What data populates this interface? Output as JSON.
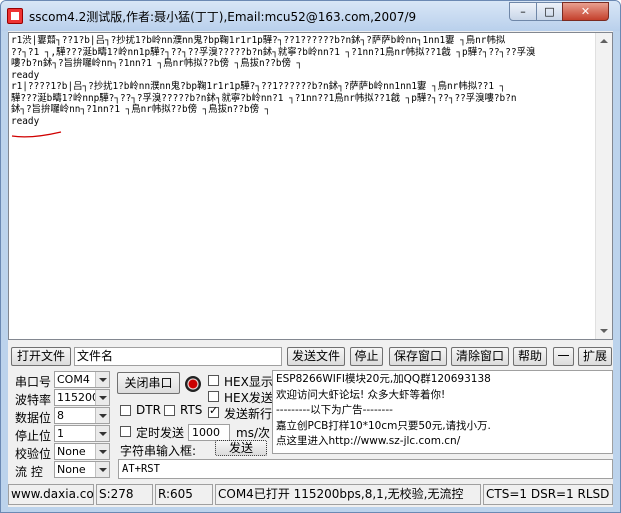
{
  "title": "sscom4.2测试版,作者:聂小猛(丁丁),Email:mcu52@163.com,2007/9",
  "window_controls": {
    "minimize": "–",
    "maximize": "□",
    "close": "✕"
  },
  "receive": {
    "lines": [
      "r1渋|寠鼘┐??1?b|吕┐?抄扰1?b岭nn濮nn鬼?bp鞠1r1r1p驊?┐??1??????b?n鉥┐?萨萨b岭nn┐1nn1寠 ┐鳥nr帏拟",
      "??┐?1 ┐,驊???涎b疇1?岭nn1p驊?┐??┐??孚溴?????b?n鉥┐就寧?b岭nn?1 ┐?1nn?1鳥nr帏拟??1戧 ┐p驊?┐??┐??孚溴",
      "嘍?b?n鉥┐?旨拚囉岭nn┐?1nn?1 ┐鳥nr帏拟??b傍 ┐鳥拔n??b傍 ┐",
      "ready",
      "r1|????1?b|吕┐?抄扰1?b岭nn濮nn鬼?bp鞠1r1r1p驊?┐??1??????b?n鉥┐?萨萨b岭nn1nn1寠 ┐鳥nr帏拟??1 ┐",
      "驊???涎b疇1?岭nnp驊?┐??┐?孚溴?????b?n鉥┐就寧?b岭nn?1 ┐?1nn??1鳥nr帏拟??1戧 ┐p驊?┐??┐??孚溴嘍?b?n",
      "鉥┐?旨拚囉岭nn┐?1nn?1 ┐鳥nr帏拟??b傍 ┐鳥拔n??b傍 ┐",
      "ready"
    ]
  },
  "buttons": {
    "open_file": "打开文件",
    "send_file": "发送文件",
    "stop": "停止",
    "save_window": "保存窗口",
    "clear_window": "清除窗口",
    "help": "帮助",
    "collapse": "一",
    "expand": "扩展",
    "close_port": "关闭串口",
    "send": "发送"
  },
  "file_name_value": "文件名",
  "settings": {
    "port_label": "串口号",
    "port_value": "COM4",
    "baud_label": "波特率",
    "baud_value": "115200",
    "data_label": "数据位",
    "data_value": "8",
    "stop_label": "停止位",
    "stop_value": "1",
    "parity_label": "校验位",
    "parity_value": "None",
    "flow_label": "流 控",
    "flow_value": "None"
  },
  "options": {
    "hex_display": "HEX显示",
    "hex_send": "HEX发送",
    "dtr": "DTR",
    "rts": "RTS",
    "send_newline": "发送新行",
    "timed_send": "定时发送",
    "interval_value": "1000",
    "interval_unit": "ms/次",
    "string_input_label": "字符串输入框:"
  },
  "option_states": {
    "hex_display": false,
    "hex_send": false,
    "dtr": false,
    "rts": false,
    "send_newline": true,
    "timed_send": false
  },
  "info_lines": [
    "ESP8266WIFI模块20元,加QQ群120693138",
    "欢迎访问大虾论坛! 众多大虾等着你!",
    "---------以下为广告--------",
    "嘉立创PCB打样10*10cm只要50元,请找小万.",
    "点这里进入http://www.sz-jlc.com.cn/"
  ],
  "send_value": "AT+RST",
  "status_bar": {
    "site": "www.daxia.cor",
    "sent": "S:278",
    "received": "R:605",
    "port_status": "COM4已打开  115200bps,8,1,无校验,无流控",
    "signals": "CTS=1 DSR=1 RLSD"
  },
  "colors": {
    "titlebar": "#b9d0ec",
    "close_button": "#c4402c",
    "annotation": "#d00000"
  }
}
